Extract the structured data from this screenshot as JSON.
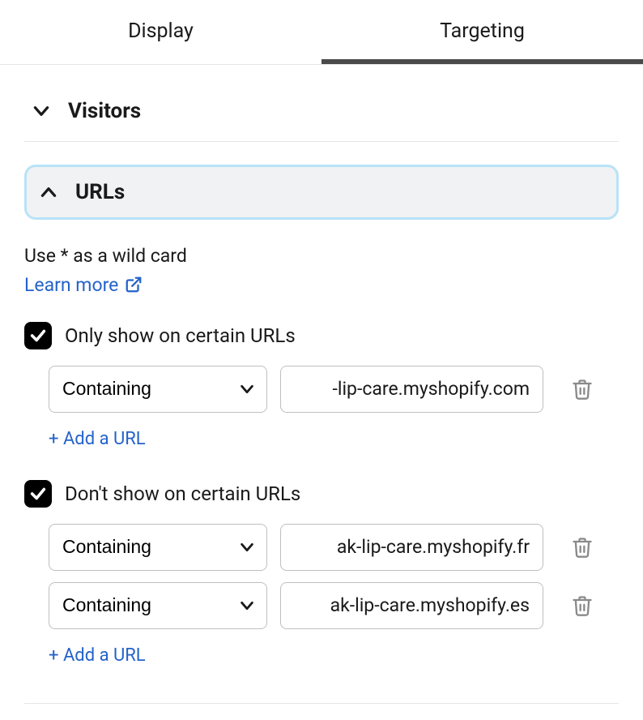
{
  "tabs": {
    "display": "Display",
    "targeting": "Targeting"
  },
  "accordion": {
    "visitors": "Visitors",
    "urls": "URLs"
  },
  "urls_section": {
    "wildcard_hint": "Use * as a wild card",
    "learn_more": "Learn more",
    "only_show": {
      "label": "Only show on certain URLs",
      "rules": [
        {
          "operator": "Containing",
          "value": "-lip-care.myshopify.com"
        }
      ],
      "add_label": "+ Add a URL"
    },
    "dont_show": {
      "label": "Don't show on certain URLs",
      "rules": [
        {
          "operator": "Containing",
          "value": "ak-lip-care.myshopify.fr"
        },
        {
          "operator": "Containing",
          "value": "ak-lip-care.myshopify.es"
        }
      ],
      "add_label": "+ Add a URL"
    }
  }
}
